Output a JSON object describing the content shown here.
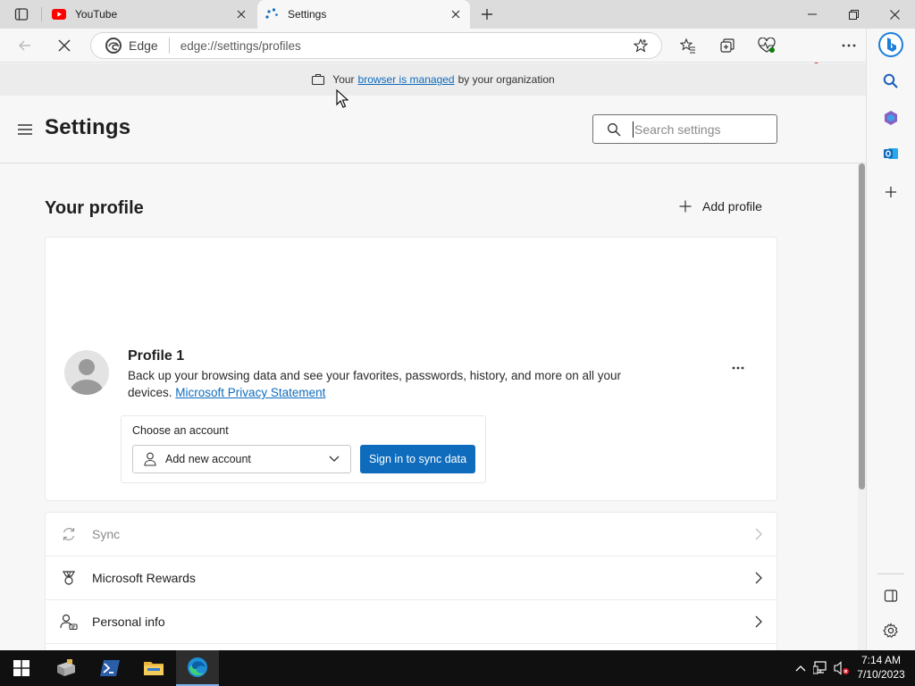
{
  "browser": {
    "tabs": [
      {
        "title": "YouTube",
        "favicon": "youtube-icon"
      },
      {
        "title": "Settings",
        "favicon": "loading-icon"
      }
    ],
    "address": {
      "edge_label": "Edge",
      "url": "edge://settings/profiles"
    },
    "managed": {
      "prefix": "Your",
      "link": "browser is managed",
      "suffix": "by your organization"
    }
  },
  "settings": {
    "title": "Settings",
    "search_placeholder": "Search settings"
  },
  "profile": {
    "section_title": "Your profile",
    "add_profile_label": "Add profile",
    "name": "Profile 1",
    "description": "Back up your browsing data and see your favorites, passwords, history, and more on all your devices.",
    "privacy_link": "Microsoft Privacy Statement",
    "choose_account_label": "Choose an account",
    "account_select_value": "Add new account",
    "sign_in_button": "Sign in to sync data"
  },
  "rows": [
    {
      "label": "Sync",
      "icon": "sync-icon",
      "disabled": true
    },
    {
      "label": "Microsoft Rewards",
      "icon": "rewards-icon",
      "disabled": false
    },
    {
      "label": "Personal info",
      "icon": "personal-info-icon",
      "disabled": false
    }
  ],
  "taskbar": {
    "time": "7:14 AM",
    "date": "7/10/2023"
  },
  "colors": {
    "accent": "#0f6cbd",
    "youtube_red": "#ff0000"
  }
}
